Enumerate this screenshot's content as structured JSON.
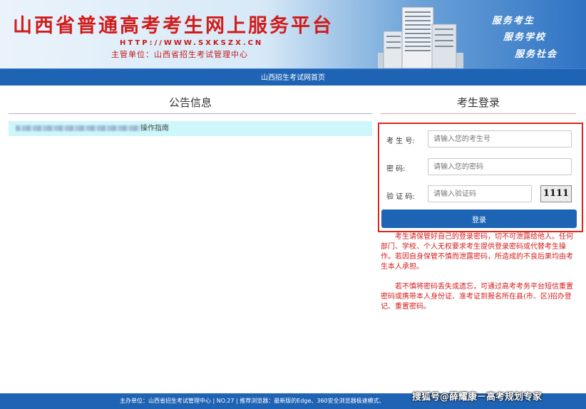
{
  "header": {
    "title": "山西省普通高考考生网上服务平台",
    "url": "HTTP://WWW.SXKSZX.CN",
    "org": "主管单位：山西省招生考试管理中心",
    "slogans": [
      "服务考生",
      "服务学校",
      "服务社会"
    ]
  },
  "nav": {
    "home_link": "山西招生考试网首页"
  },
  "notice": {
    "title": "公告信息",
    "item_suffix": "操作指南"
  },
  "login": {
    "title": "考生登录",
    "exam_id_label": "考 生 号:",
    "exam_id_placeholder": "请输入您的考生号",
    "password_label": "密   码:",
    "password_placeholder": "请输入您的密码",
    "captcha_label": "验 证 码:",
    "captcha_placeholder": "请输入验证码",
    "captcha_value": "1111",
    "submit_label": "登录"
  },
  "warnings": [
    "考生请保管好自己的登录密码，切不可泄露给他人。任何部门、学校、个人无权要求考生提供登录密码或代替考生操作。若因自身保管不慎而泄露密码，所造成的不良后果均由考生本人承担。",
    "若不慎将密码丢失或遗忘，可通过高考考务平台短信重置密码或携带本人身份证、准考证到报名所在县(市、区)招办登记、重置密码。"
  ],
  "footer": {
    "text": "主办单位：山西省招生考试管理中心  |  NO.27  |  推荐浏览器：最新版的Edge、360安全浏览器极速模式、"
  },
  "watermark": "搜狐号@薛耀康－高考规划专家",
  "colors": {
    "brand_blue": "#1e63b4",
    "title_red": "#d11c1c",
    "notice_bg": "#cdf7fb"
  }
}
